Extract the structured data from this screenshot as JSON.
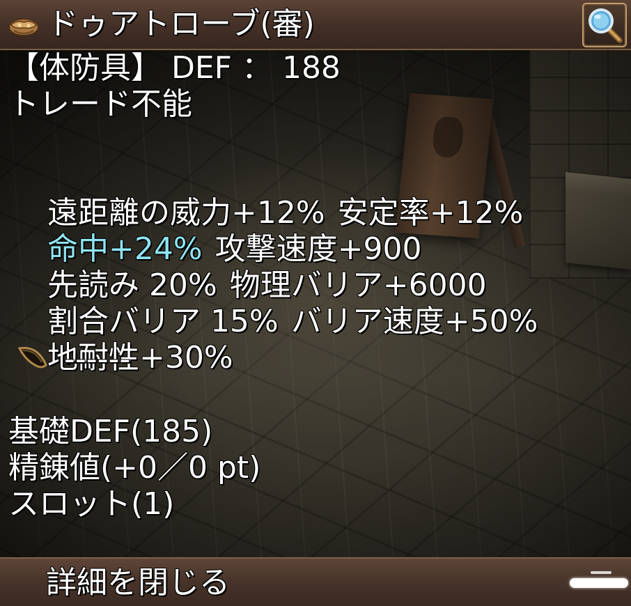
{
  "header": {
    "item_name": "ドゥアトローブ(審)",
    "item_icon": "robe-armor-icon",
    "zoom_icon": "magnifier-icon"
  },
  "info": {
    "category_line": "【体防具】 DEF ： 188",
    "trade_line": "トレード不能",
    "options": [
      {
        "text": "遠距離の威力+12%",
        "color": "#ffffff"
      },
      {
        "text": "安定率+12%",
        "color": "#ffffff"
      },
      {
        "text": "命中+24%",
        "color": "#8fe4f2"
      },
      {
        "text": "攻撃速度+900",
        "color": "#ffffff"
      },
      {
        "text": "先読み 20%",
        "color": "#ffffff"
      },
      {
        "text": "物理バリア+6000",
        "color": "#ffffff"
      },
      {
        "text": "割合バリア 15%",
        "color": "#ffffff"
      },
      {
        "text": "バリア速度+50%",
        "color": "#ffffff"
      },
      {
        "text": "地耐性+30%",
        "color": "#ffffff"
      }
    ],
    "socket": {
      "icon": "seed-icon",
      "text": "------"
    },
    "base_def": "基礎DEF(185)",
    "refine": "精錬値(+0／0 pt)",
    "slot": "スロット(1)"
  },
  "footer": {
    "close_label": "詳細を閉じる"
  },
  "colors": {
    "text": "#ffffff",
    "highlight": "#8fe4f2",
    "bar": "#4a352a",
    "bar_border": "#7a5d44"
  }
}
